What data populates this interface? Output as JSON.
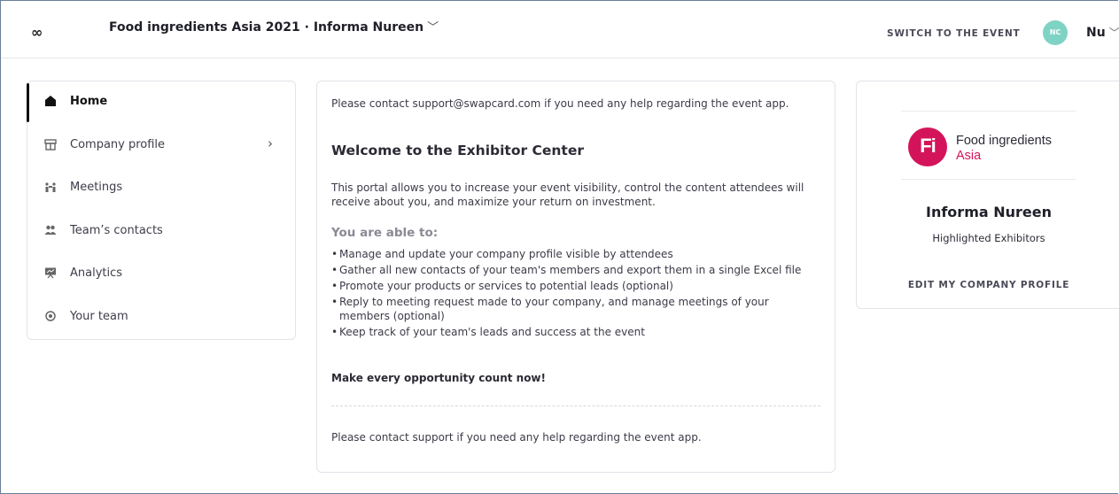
{
  "header": {
    "logo": "∞",
    "event_title": "Food ingredients Asia 2021 · Informa Nureen",
    "switch_link": "SWITCH TO THE EVENT",
    "avatar_initials": "NC",
    "user_name": "Nu",
    "avatar_color": "#7fd3c5"
  },
  "sidebar": {
    "items": [
      {
        "label": "Home",
        "icon": "home-icon",
        "active": true
      },
      {
        "label": "Company profile",
        "icon": "store-icon"
      },
      {
        "label": "Meetings",
        "icon": "meetings-icon"
      },
      {
        "label": "Team’s contacts",
        "icon": "contacts-icon"
      },
      {
        "label": "Analytics",
        "icon": "analytics-icon"
      },
      {
        "label": "Your team",
        "icon": "team-icon"
      }
    ]
  },
  "main": {
    "support_top": "Please contact support@swapcard.com if you need any help regarding the event app.",
    "welcome_title": "Welcome to the Exhibitor Center",
    "portal_text": "This portal allows you to increase your event visibility, control the content attendees will receive about you, and maximize your return on investment.",
    "able_heading": "You are able to:",
    "bullets": [
      "Manage and update your company profile visible by attendees",
      "Gather all new contacts of your team's members and export them in a single Excel file",
      "Promote your products or services to potential leads (optional)",
      "Reply to meeting request made to your company, and manage meetings of your members (optional)",
      "Keep track of your team's leads and success at the event"
    ],
    "make_every": "Make every opportunity count now!",
    "support_bottom": "Please contact support if you need any help regarding the event app."
  },
  "company": {
    "logo_mark": "Fi",
    "logo_line1": "Food ingredients",
    "logo_line2": "Asia",
    "logo_color": "#d4145a",
    "name": "Informa Nureen",
    "subtitle": "Highlighted Exhibitors",
    "edit_label": "EDIT MY COMPANY PROFILE"
  }
}
